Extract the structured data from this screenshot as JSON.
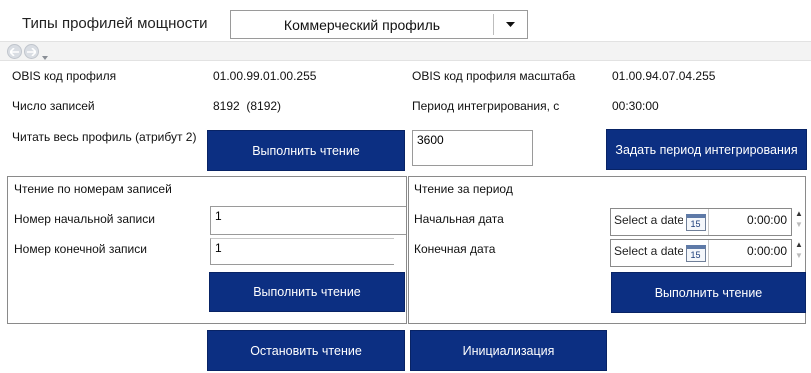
{
  "header": {
    "label": "Типы профилей мощности",
    "dropdown_value": "Коммерческий профиль"
  },
  "nav": {
    "back_icon": "back-arrow-icon",
    "forward_icon": "forward-arrow-icon"
  },
  "info": {
    "obis_label": "OBIS код профиля",
    "obis_value": "01.00.99.01.00.255",
    "obis_scale_label": "OBIS код профиля масштаба",
    "obis_scale_value": "01.00.94.07.04.255",
    "count_label": "Число записей",
    "count_value": "8192  (8192)",
    "period_label": "Период интегрирования, с",
    "period_value": "00:30:00"
  },
  "read_all": {
    "label": "Читать весь профиль (атрибут 2)",
    "button": "Выполнить чтение",
    "period_input": "3600",
    "set_period_button": "Задать период интегрирования"
  },
  "by_records": {
    "title": "Чтение по номерам записей",
    "start_label": "Номер начальной записи",
    "start_value": "1",
    "end_label": "Номер конечной записи",
    "end_value": "1",
    "button": "Выполнить чтение"
  },
  "by_period": {
    "title": "Чтение за период",
    "start_label": "Начальная дата",
    "start_placeholder": "Select a date",
    "start_time": "0:00:00",
    "end_label": "Конечная дата",
    "end_placeholder": "Select a date",
    "end_time": "0:00:00",
    "calendar_day": "15",
    "button": "Выполнить чтение"
  },
  "footer": {
    "stop_button": "Остановить чтение",
    "init_button": "Инициализация"
  }
}
